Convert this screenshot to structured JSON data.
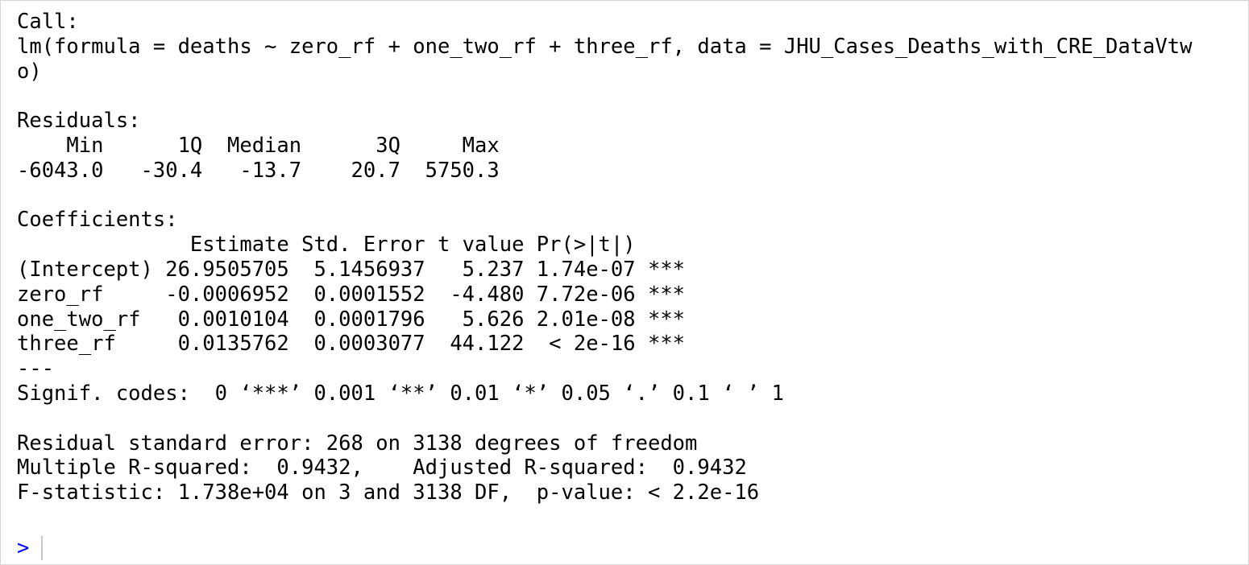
{
  "console": {
    "lines": [
      "Call:",
      "lm(formula = deaths ~ zero_rf + one_two_rf + three_rf, data = JHU_Cases_Deaths_with_CRE_DataVtw",
      "o)",
      "",
      "Residuals:",
      "    Min      1Q  Median      3Q     Max ",
      "-6043.0   -30.4   -13.7    20.7  5750.3 ",
      "",
      "Coefficients:",
      "              Estimate Std. Error t value Pr(>|t|)    ",
      "(Intercept) 26.9505705  5.1456937   5.237 1.74e-07 ***",
      "zero_rf     -0.0006952  0.0001552  -4.480 7.72e-06 ***",
      "one_two_rf   0.0010104  0.0001796   5.626 2.01e-08 ***",
      "three_rf     0.0135762  0.0003077  44.122  < 2e-16 ***",
      "---",
      "Signif. codes:  0 ‘***’ 0.001 ‘**’ 0.01 ‘*’ 0.05 ‘.’ 0.1 ‘ ’ 1",
      "",
      "Residual standard error: 268 on 3138 degrees of freedom",
      "Multiple R-squared:  0.9432,\tAdjusted R-squared:  0.9432 ",
      "F-statistic: 1.738e+04 on 3 and 3138 DF,  p-value: < 2.2e-16"
    ],
    "prompt_symbol": ">",
    "input_value": ""
  },
  "colors": {
    "background": "#ffffff",
    "text": "#000000",
    "prompt": "#0000ff"
  }
}
